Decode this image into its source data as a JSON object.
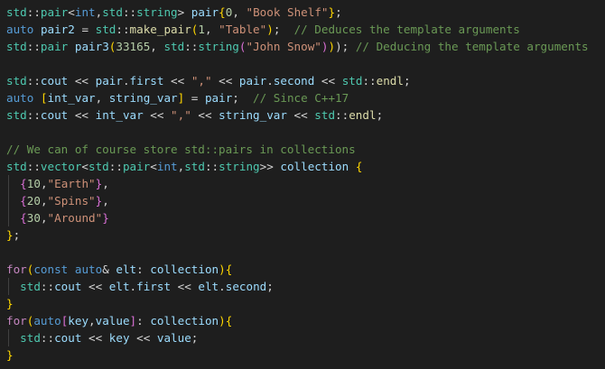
{
  "editor": {
    "theme_colors": {
      "background": "#1e1e1e",
      "namespace": "#4ec9b0",
      "keyword": "#569cd6",
      "control": "#c586c0",
      "string": "#ce9178",
      "number": "#b5cea8",
      "comment": "#6a9955",
      "function": "#dcdcaa",
      "variable": "#9cdcfe",
      "bracket_gold": "#ffd700",
      "bracket_purple": "#da70d6",
      "bracket_blue": "#179fff"
    },
    "lines": [
      [
        [
          "ns",
          "std"
        ],
        [
          "pun",
          "::"
        ],
        [
          "typ",
          "pair"
        ],
        [
          "pun",
          "<"
        ],
        [
          "kw",
          "int"
        ],
        [
          "pun",
          ","
        ],
        [
          "ns",
          "std"
        ],
        [
          "pun",
          "::"
        ],
        [
          "typ",
          "string"
        ],
        [
          "pun",
          "> "
        ],
        [
          "var",
          "pair"
        ],
        [
          "br1",
          "{"
        ],
        [
          "num",
          "0"
        ],
        [
          "pun",
          ", "
        ],
        [
          "str",
          "\"Book Shelf\""
        ],
        [
          "br1",
          "}"
        ],
        [
          "pun",
          ";"
        ]
      ],
      [
        [
          "kw",
          "auto"
        ],
        [
          "pun",
          " "
        ],
        [
          "var",
          "pair2"
        ],
        [
          "pun",
          " = "
        ],
        [
          "ns",
          "std"
        ],
        [
          "pun",
          "::"
        ],
        [
          "fn",
          "make_pair"
        ],
        [
          "br1",
          "("
        ],
        [
          "num",
          "1"
        ],
        [
          "pun",
          ", "
        ],
        [
          "str",
          "\"Table\""
        ],
        [
          "br1",
          ")"
        ],
        [
          "pun",
          ";  "
        ],
        [
          "cmt",
          "// Deduces the template arguments"
        ]
      ],
      [
        [
          "ns",
          "std"
        ],
        [
          "pun",
          "::"
        ],
        [
          "typ",
          "pair"
        ],
        [
          "pun",
          " "
        ],
        [
          "var",
          "pair3"
        ],
        [
          "br1",
          "("
        ],
        [
          "num",
          "33165"
        ],
        [
          "pun",
          ", "
        ],
        [
          "ns",
          "std"
        ],
        [
          "pun",
          "::"
        ],
        [
          "typ",
          "string"
        ],
        [
          "br2",
          "("
        ],
        [
          "str",
          "\"John Snow\""
        ],
        [
          "br2",
          ")"
        ],
        [
          "br1",
          ")"
        ],
        [
          "pun",
          "); "
        ],
        [
          "cmt",
          "// Deducing the template arguments"
        ]
      ],
      [],
      [
        [
          "ns",
          "std"
        ],
        [
          "pun",
          "::"
        ],
        [
          "var",
          "cout"
        ],
        [
          "pun",
          " << "
        ],
        [
          "var",
          "pair"
        ],
        [
          "pun",
          "."
        ],
        [
          "var",
          "first"
        ],
        [
          "pun",
          " << "
        ],
        [
          "str",
          "\",\""
        ],
        [
          "pun",
          " << "
        ],
        [
          "var",
          "pair"
        ],
        [
          "pun",
          "."
        ],
        [
          "var",
          "second"
        ],
        [
          "pun",
          " << "
        ],
        [
          "ns",
          "std"
        ],
        [
          "pun",
          "::"
        ],
        [
          "fn",
          "endl"
        ],
        [
          "pun",
          ";"
        ]
      ],
      [
        [
          "kw",
          "auto"
        ],
        [
          "pun",
          " "
        ],
        [
          "br1",
          "["
        ],
        [
          "var",
          "int_var"
        ],
        [
          "pun",
          ", "
        ],
        [
          "var",
          "string_var"
        ],
        [
          "br1",
          "]"
        ],
        [
          "pun",
          " = "
        ],
        [
          "var",
          "pair"
        ],
        [
          "pun",
          ";  "
        ],
        [
          "cmt",
          "// Since C++17"
        ]
      ],
      [
        [
          "ns",
          "std"
        ],
        [
          "pun",
          "::"
        ],
        [
          "var",
          "cout"
        ],
        [
          "pun",
          " << "
        ],
        [
          "var",
          "int_var"
        ],
        [
          "pun",
          " << "
        ],
        [
          "str",
          "\",\""
        ],
        [
          "pun",
          " << "
        ],
        [
          "var",
          "string_var"
        ],
        [
          "pun",
          " << "
        ],
        [
          "ns",
          "std"
        ],
        [
          "pun",
          "::"
        ],
        [
          "fn",
          "endl"
        ],
        [
          "pun",
          ";"
        ]
      ],
      [],
      [
        [
          "cmt",
          "// We can of course store std::pairs in collections"
        ]
      ],
      [
        [
          "ns",
          "std"
        ],
        [
          "pun",
          "::"
        ],
        [
          "typ",
          "vector"
        ],
        [
          "pun",
          "<"
        ],
        [
          "ns",
          "std"
        ],
        [
          "pun",
          "::"
        ],
        [
          "typ",
          "pair"
        ],
        [
          "pun",
          "<"
        ],
        [
          "kw",
          "int"
        ],
        [
          "pun",
          ","
        ],
        [
          "ns",
          "std"
        ],
        [
          "pun",
          "::"
        ],
        [
          "typ",
          "string"
        ],
        [
          "pun",
          ">> "
        ],
        [
          "var",
          "collection"
        ],
        [
          "pun",
          " "
        ],
        [
          "br1",
          "{"
        ]
      ],
      [
        [
          "pun",
          "  "
        ],
        [
          "br2",
          "{"
        ],
        [
          "num",
          "10"
        ],
        [
          "pun",
          ","
        ],
        [
          "str",
          "\"Earth\""
        ],
        [
          "br2",
          "}"
        ],
        [
          "pun",
          ","
        ]
      ],
      [
        [
          "pun",
          "  "
        ],
        [
          "br2",
          "{"
        ],
        [
          "num",
          "20"
        ],
        [
          "pun",
          ","
        ],
        [
          "str",
          "\"Spins\""
        ],
        [
          "br2",
          "}"
        ],
        [
          "pun",
          ","
        ]
      ],
      [
        [
          "pun",
          "  "
        ],
        [
          "br2",
          "{"
        ],
        [
          "num",
          "30"
        ],
        [
          "pun",
          ","
        ],
        [
          "str",
          "\"Around\""
        ],
        [
          "br2",
          "}"
        ]
      ],
      [
        [
          "br1",
          "}"
        ],
        [
          "pun",
          ";"
        ]
      ],
      [],
      [
        [
          "ctl",
          "for"
        ],
        [
          "br1",
          "("
        ],
        [
          "kw",
          "const"
        ],
        [
          "pun",
          " "
        ],
        [
          "kw",
          "auto"
        ],
        [
          "pun",
          "& "
        ],
        [
          "var",
          "elt"
        ],
        [
          "pun",
          ": "
        ],
        [
          "var",
          "collection"
        ],
        [
          "br1",
          ")"
        ],
        [
          "br1",
          "{"
        ]
      ],
      [
        [
          "pun",
          "  "
        ],
        [
          "ns",
          "std"
        ],
        [
          "pun",
          "::"
        ],
        [
          "var",
          "cout"
        ],
        [
          "pun",
          " << "
        ],
        [
          "var",
          "elt"
        ],
        [
          "pun",
          "."
        ],
        [
          "var",
          "first"
        ],
        [
          "pun",
          " << "
        ],
        [
          "var",
          "elt"
        ],
        [
          "pun",
          "."
        ],
        [
          "var",
          "second"
        ],
        [
          "pun",
          ";"
        ]
      ],
      [
        [
          "br1",
          "}"
        ]
      ],
      [
        [
          "ctl",
          "for"
        ],
        [
          "br1",
          "("
        ],
        [
          "kw",
          "auto"
        ],
        [
          "br2",
          "["
        ],
        [
          "var",
          "key"
        ],
        [
          "pun",
          ","
        ],
        [
          "var",
          "value"
        ],
        [
          "br2",
          "]"
        ],
        [
          "pun",
          ": "
        ],
        [
          "var",
          "collection"
        ],
        [
          "br1",
          ")"
        ],
        [
          "br1",
          "{"
        ]
      ],
      [
        [
          "pun",
          "  "
        ],
        [
          "ns",
          "std"
        ],
        [
          "pun",
          "::"
        ],
        [
          "var",
          "cout"
        ],
        [
          "pun",
          " << "
        ],
        [
          "var",
          "key"
        ],
        [
          "pun",
          " << "
        ],
        [
          "var",
          "value"
        ],
        [
          "pun",
          ";"
        ]
      ],
      [
        [
          "br1",
          "}"
        ]
      ]
    ],
    "indent_guides": [
      10,
      11,
      12,
      16,
      19
    ]
  }
}
